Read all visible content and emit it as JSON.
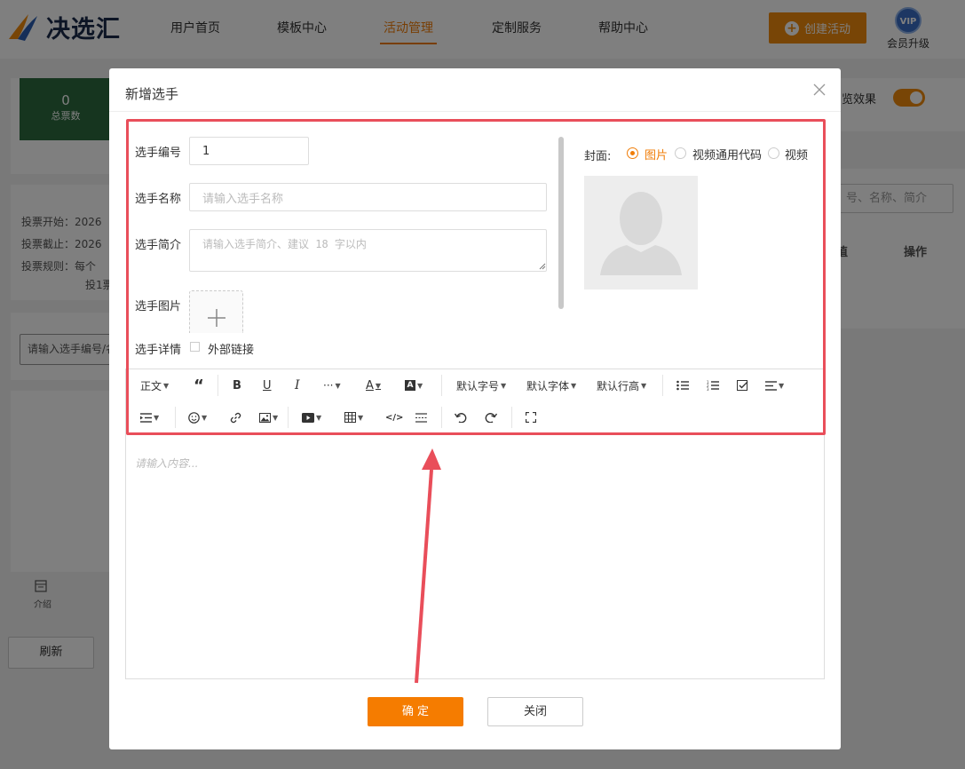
{
  "header": {
    "brand": "决选汇",
    "nav": [
      "用户首页",
      "模板中心",
      "活动管理",
      "定制服务",
      "帮助中心"
    ],
    "active_nav": "活动管理",
    "create_button": "创建活动",
    "vip_badge": "VIP",
    "vip_label": "会员升级"
  },
  "background": {
    "stat_value": "0",
    "stat_label": "总票数",
    "vote_start": "投票开始：2026",
    "vote_end": "投票截止：2026",
    "vote_rule": "投票规则：每个",
    "vote_rule_2": "投1票",
    "search_placeholder": "请输入选手编号/名",
    "intro_label": "介绍",
    "refresh_button": "刷新",
    "preview_label": "览效果",
    "right_search_placeholder": "号、名称、简介",
    "column_partial": "值",
    "column_action": "操作"
  },
  "modal": {
    "title": "新增选手",
    "form": {
      "number_label": "选手编号",
      "number_value": "1",
      "name_label": "选手名称",
      "name_placeholder": "请输入选手名称",
      "intro_label": "选手简介",
      "intro_placeholder": "请输入选手简介、建议 18 字以内",
      "image_label": "选手图片",
      "detail_label": "选手详情",
      "external_link_label": "外部链接"
    },
    "cover": {
      "label": "封面:",
      "options": [
        "图片",
        "视频通用代码",
        "视频"
      ],
      "selected": "图片"
    },
    "toolbar": {
      "paragraph": "正文",
      "font_size": "默认字号",
      "font_family": "默认字体",
      "line_height": "默认行高"
    },
    "editor_placeholder": "请输入内容...",
    "confirm_button": "确 定",
    "close_button": "关闭"
  },
  "colors": {
    "accent": "#f07d08",
    "highlight": "#e94e5a",
    "brand_dark": "#1b2a4a"
  }
}
